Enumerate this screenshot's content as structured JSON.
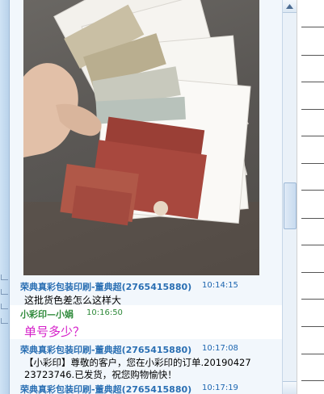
{
  "messages": [
    {
      "sender": "荣典真彩包装印刷-董典超(2765415880)",
      "time": "10:14:15",
      "text": "这批货色差怎么这样大"
    },
    {
      "sender": "小彩印—小娟",
      "time": "10:16:50",
      "text": "单号多少？"
    },
    {
      "sender": "荣典真彩包装印刷-董典超(2765415880)",
      "time": "10:17:08",
      "text_line1": "【小彩印】尊敬的客户，您在小彩印的订单.20190427",
      "text_line2": "23723746.已发货，祝您购物愉快！"
    },
    {
      "sender": "荣典真彩包装印刷-董典超(2765415880)",
      "time": "10:17:19"
    }
  ],
  "colors": {
    "sender_blue": "#2a6fb3",
    "sender_green": "#2f8a3a",
    "question_magenta": "#d51fc9"
  },
  "icons": {
    "scroll_up": "triangle-up",
    "scroll_down": "triangle-down"
  }
}
